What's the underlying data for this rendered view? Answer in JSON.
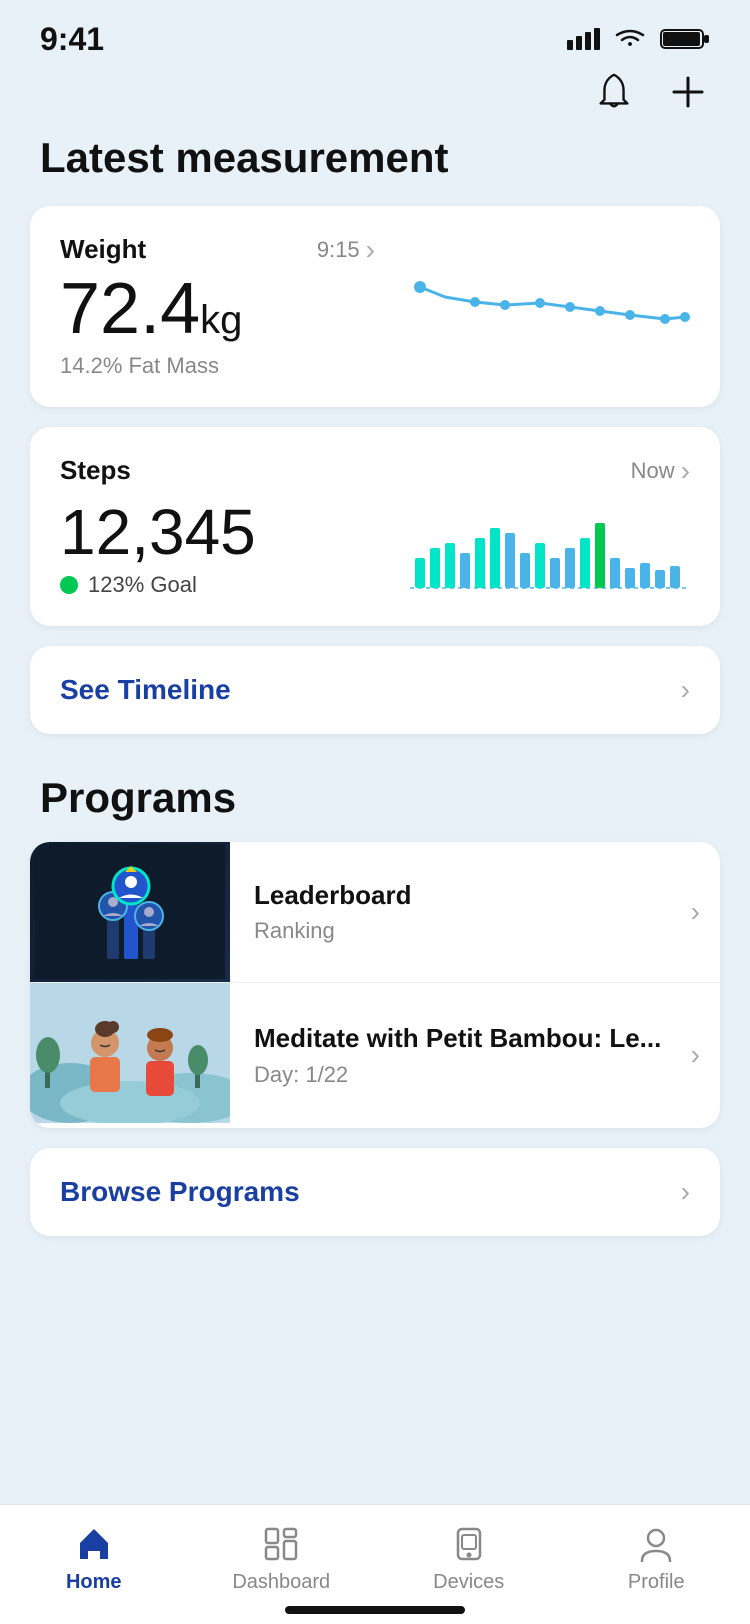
{
  "statusBar": {
    "time": "9:41"
  },
  "header": {
    "notificationLabel": "notification",
    "addLabel": "add"
  },
  "latestMeasurement": {
    "title": "Latest measurement",
    "weightCard": {
      "label": "Weight",
      "time": "9:15",
      "value": "72.4",
      "unit": "kg",
      "sub": "14.2% Fat Mass"
    },
    "stepsCard": {
      "label": "Steps",
      "time": "Now",
      "value": "12,345",
      "goal": "123% Goal"
    },
    "seeTimeline": "See Timeline"
  },
  "programs": {
    "title": "Programs",
    "items": [
      {
        "title": "Leaderboard",
        "sub": "Ranking"
      },
      {
        "title": "Meditate with Petit Bambou: Le...",
        "sub": "Day: 1/22"
      }
    ],
    "browse": "Browse Programs"
  },
  "bottomNav": {
    "items": [
      {
        "label": "Home",
        "active": true
      },
      {
        "label": "Dashboard",
        "active": false
      },
      {
        "label": "Devices",
        "active": false
      },
      {
        "label": "Profile",
        "active": false
      }
    ]
  }
}
